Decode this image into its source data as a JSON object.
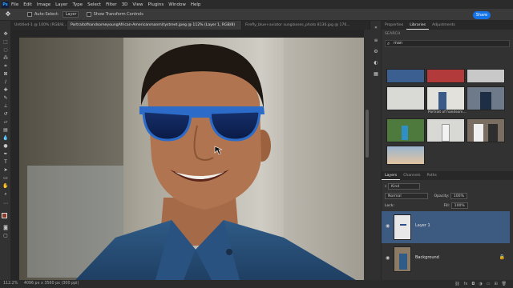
{
  "menubar": {
    "logo": "Ps",
    "items": [
      "File",
      "Edit",
      "Image",
      "Layer",
      "Type",
      "Select",
      "Filter",
      "3D",
      "View",
      "Plugins",
      "Window",
      "Help"
    ],
    "share_label": "Share"
  },
  "options": {
    "auto_select_label": "Auto-Select:",
    "auto_select_value": "Layer",
    "transform_label": "Show Transform Controls"
  },
  "doc_tabs": [
    "Untitled-1 @ 100% (RGB/8...",
    "PortraitofhandsomeyoungAfrican-Americanmanm(tystreet.jpeg @ 112% (Layer 1, RGB/8)",
    "Firefly_blue+aviator sunglasses_photo 8136.jpg @ 176..."
  ],
  "panel": {
    "tabs": [
      "Properties",
      "Libraries",
      "Adjustments"
    ],
    "active_tab": "Libraries",
    "search_label": "SEARCH",
    "search_value": "man",
    "thumb_caption": "Portrait of handsom..."
  },
  "layers": {
    "tabs": [
      "Layers",
      "Channels",
      "Paths"
    ],
    "kind_label": "Kind",
    "blend_mode": "Normal",
    "opacity_label": "Opacity:",
    "opacity_value": "100%",
    "lock_label": "Lock:",
    "fill_label": "Fill:",
    "fill_value": "100%",
    "items": [
      {
        "name": "Layer 1"
      },
      {
        "name": "Background"
      }
    ]
  },
  "status": {
    "zoom": "112.2%",
    "doc_size": "4096 px x 3560 px (300 ppi)"
  },
  "colors": {
    "accent": "#1473e6",
    "selected_layer": "#3d5a80"
  }
}
